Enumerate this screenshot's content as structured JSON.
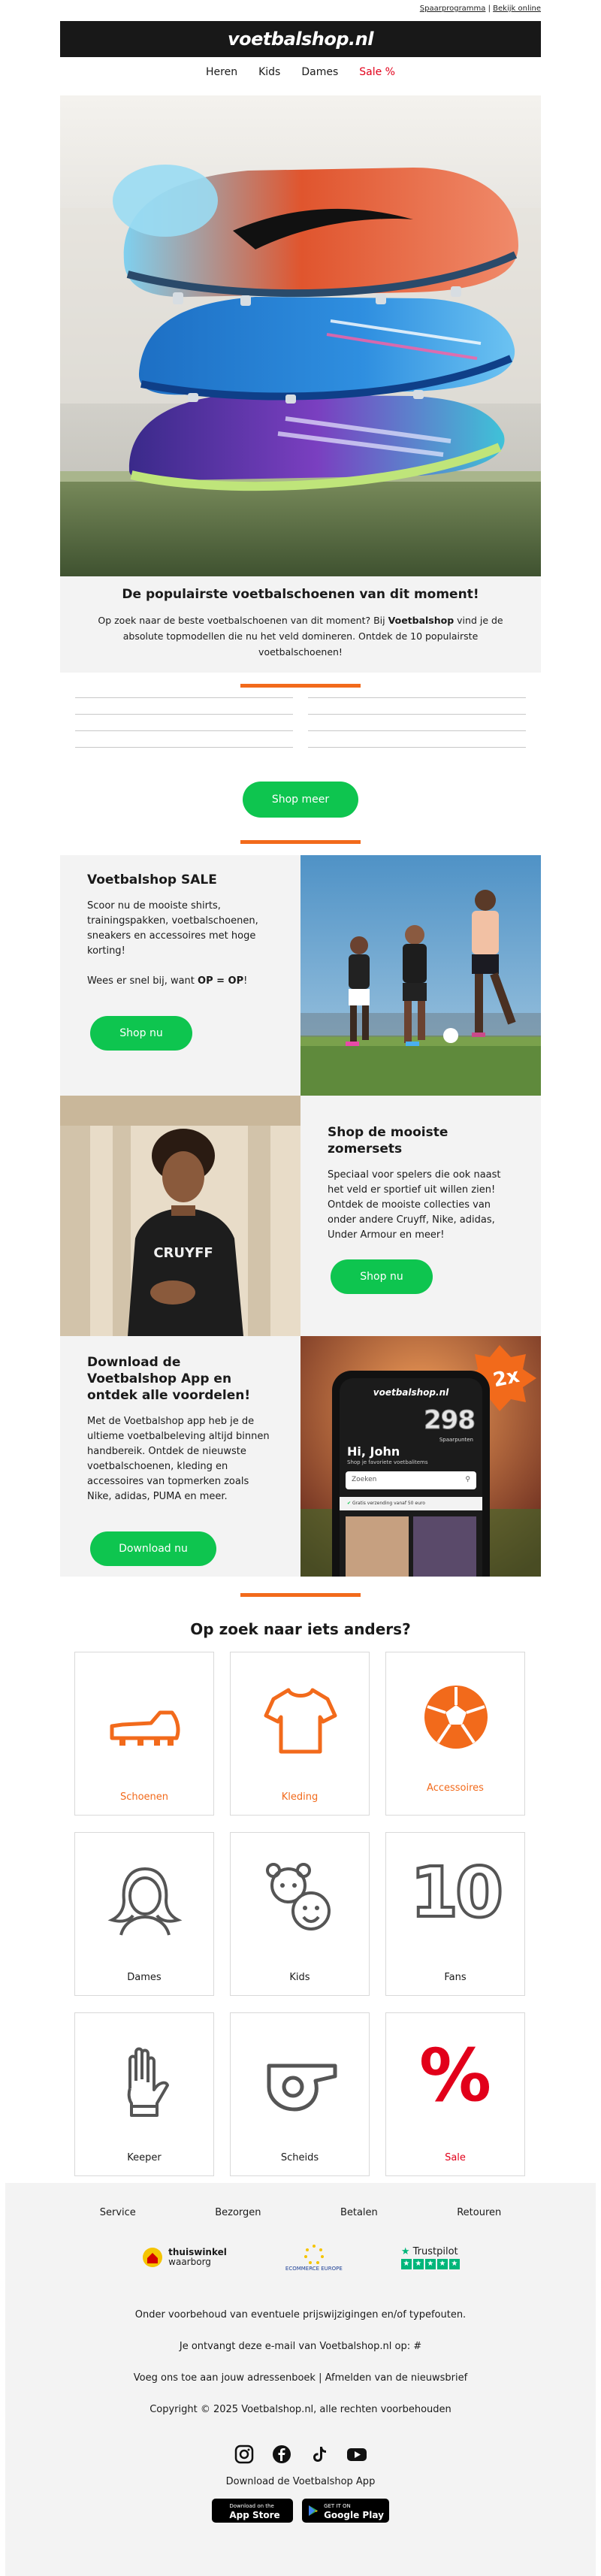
{
  "toplinks": {
    "spaar": "Spaarprogramma",
    "sep": " | ",
    "online": "Bekijk online"
  },
  "header": {
    "logo": "voetbalshop.nl"
  },
  "nav": {
    "heren": "Heren",
    "kids": "Kids",
    "dames": "Dames",
    "sale": "Sale %"
  },
  "hero": {
    "title": "De populairste voetbalschoenen van dit moment!",
    "text_1": "Op zoek naar de beste voetbalschoenen van dit moment? Bij ",
    "brand": "Voetbalshop",
    "text_2": " vind je de absolute topmodellen die nu het veld domineren. Ontdek de 10 populairste voetbalschoenen!",
    "button": "Shop meer"
  },
  "sale_block": {
    "title": "Voetbalshop SALE",
    "text": "Scoor nu de mooiste shirts, trainingspakken, voetbalschoenen, sneakers en accessoires met hoge korting!",
    "text2_a": "Wees er snel bij, want ",
    "text2_b": "OP = OP",
    "text2_c": "!",
    "button": "Shop nu"
  },
  "summer_block": {
    "title": "Shop de mooiste zomersets",
    "text": "Speciaal voor spelers die ook naast het veld er sportief uit willen zien! Ontdek de mooiste collecties van onder andere Cruyff, Nike, adidas, Under Armour en meer!",
    "button": "Shop nu",
    "shirt_print": "CRUYFF"
  },
  "app_block": {
    "title": "Download de Voetbalshop App en ontdek alle voordelen!",
    "text": "Met de Voetbalshop app heb je de ultieme voetbalbeleving altijd binnen handbereik. Ontdek de nieuwste voetbalschoenen, kleding en accessoires van topmerken zoals Nike, adidas, PUMA en meer.",
    "button": "Download nu",
    "phone_logo": "voetbalshop.nl",
    "phone_points": "298",
    "phone_points_label": "Spaarpunten",
    "phone_greeting": "Hi, John",
    "phone_sub": "Shop je favoriete voetbalitems",
    "phone_search": "Zoeken",
    "phone_notice": "Gratis verzending vanaf 50 euro",
    "badge": "2x"
  },
  "categories": {
    "title": "Op zoek naar iets anders?",
    "items": [
      {
        "label": "Schoenen",
        "icon": "football-boot-icon",
        "color": "#f26a1b"
      },
      {
        "label": "Kleding",
        "icon": "shirt-icon",
        "color": "#f26a1b"
      },
      {
        "label": "Accessoires",
        "icon": "football-icon",
        "color": "#f26a1b"
      },
      {
        "label": "Dames",
        "icon": "woman-icon",
        "color": "#222222"
      },
      {
        "label": "Kids",
        "icon": "kids-icon",
        "color": "#222222"
      },
      {
        "label": "Fans",
        "icon": "number-ten-icon",
        "color": "#222222",
        "glyph": "10"
      },
      {
        "label": "Keeper",
        "icon": "goalkeeper-glove-icon",
        "color": "#222222"
      },
      {
        "label": "Scheids",
        "icon": "whistle-icon",
        "color": "#222222"
      },
      {
        "label": "Sale",
        "icon": "percent-icon",
        "color": "#e2001a",
        "glyph": "%"
      }
    ]
  },
  "footer": {
    "nav": [
      "Service",
      "Bezorgen",
      "Betalen",
      "Retouren"
    ],
    "thuiswinkel_1": "thuiswinkel",
    "thuiswinkel_2": "waarborg",
    "ecommerce": "ECOMMERCE EUROPE",
    "trustpilot": "Trustpilot",
    "disclaimer": "Onder voorbehoud van eventuele prijswijzigingen en/of typefouten.",
    "email_line": "Je ontvangt deze e-mail van Voetbalshop.nl op: #",
    "addressbook": "Voeg ons toe aan jouw adressenboek",
    "sep": " | ",
    "unsubscribe": "Afmelden van de nieuwsbrief",
    "copyright": "Copyright © 2025 Voetbalshop.nl, alle rechten voorbehouden",
    "app_title": "Download de Voetbalshop App",
    "appstore_small": "Download on the",
    "appstore": "App Store",
    "googleplay_small": "GET IT ON",
    "googleplay": "Google Play"
  },
  "colors": {
    "accent": "#f26a1b",
    "button": "#0ec54f",
    "sale": "#e2001a",
    "header": "#181818"
  }
}
